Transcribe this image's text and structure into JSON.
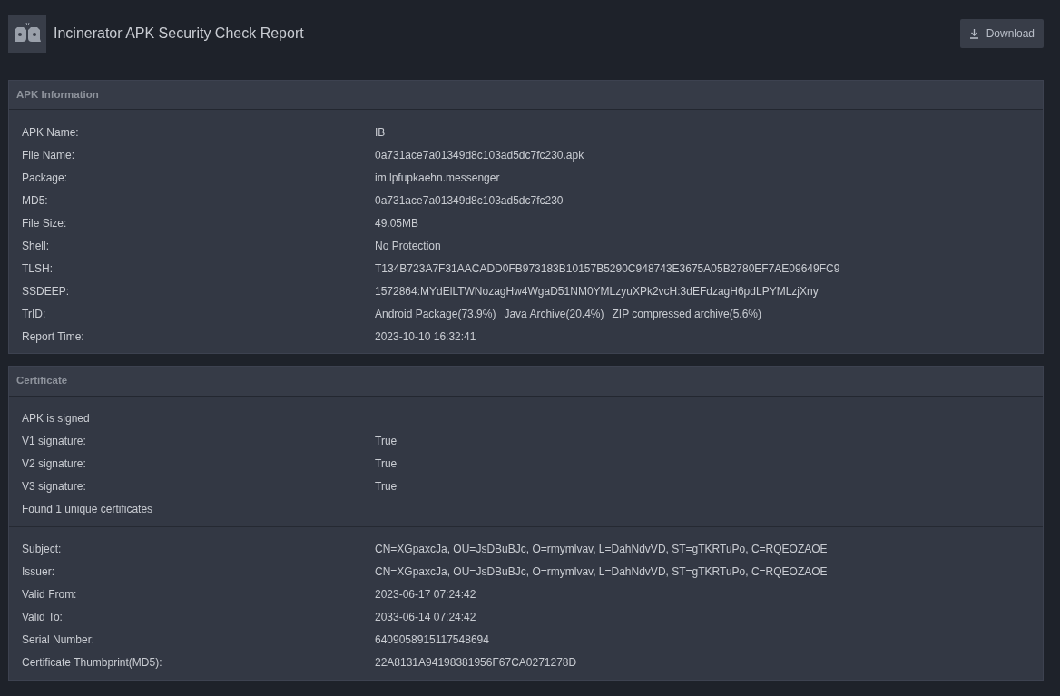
{
  "header": {
    "title": "Incinerator APK Security Check Report",
    "download_button": "Download"
  },
  "sections": [
    {
      "title": "APK Information",
      "groups": [
        [
          {
            "label": "APK Name:",
            "values": [
              "IB"
            ]
          },
          {
            "label": "File Name:",
            "values": [
              "0a731ace7a01349d8c103ad5dc7fc230.apk"
            ]
          },
          {
            "label": "Package:",
            "values": [
              "im.lpfupkaehn.messenger"
            ]
          },
          {
            "label": "MD5:",
            "values": [
              "0a731ace7a01349d8c103ad5dc7fc230"
            ]
          },
          {
            "label": "File Size:",
            "values": [
              "49.05MB"
            ]
          },
          {
            "label": "Shell:",
            "values": [
              "No Protection"
            ]
          },
          {
            "label": "TLSH:",
            "values": [
              "T134B723A7F31AACADD0FB973183B10157B5290C948743E3675A05B2780EF7AE09649FC9"
            ]
          },
          {
            "label": "SSDEEP:",
            "values": [
              "1572864:MYdElLTWNozagHw4WgaD51NM0YMLzyuXPk2vcH:3dEFdzagH6pdLPYMLzjXny"
            ]
          },
          {
            "label": "TrID:",
            "values": [
              "Android Package(73.9%)",
              "Java Archive(20.4%)",
              "ZIP compressed archive(5.6%)"
            ]
          },
          {
            "label": "Report Time:",
            "values": [
              "2023-10-10 16:32:41"
            ]
          }
        ]
      ]
    },
    {
      "title": "Certificate",
      "groups": [
        [
          {
            "label": "APK is signed"
          },
          {
            "label": "V1 signature:",
            "values": [
              "True"
            ]
          },
          {
            "label": "V2 signature:",
            "values": [
              "True"
            ]
          },
          {
            "label": "V3 signature:",
            "values": [
              "True"
            ]
          },
          {
            "label": "Found 1 unique certificates"
          }
        ],
        [
          {
            "label": "Subject:",
            "values": [
              "CN=XGpaxcJa, OU=JsDBuBJc, O=rmymlvav, L=DahNdvVD, ST=gTKRTuPo, C=RQEOZAOE"
            ]
          },
          {
            "label": "Issuer:",
            "values": [
              "CN=XGpaxcJa, OU=JsDBuBJc, O=rmymlvav, L=DahNdvVD, ST=gTKRTuPo, C=RQEOZAOE"
            ]
          },
          {
            "label": "Valid From:",
            "values": [
              "2023-06-17 07:24:42"
            ]
          },
          {
            "label": "Valid To:",
            "values": [
              "2033-06-14 07:24:42"
            ]
          },
          {
            "label": "Serial Number:",
            "values": [
              "6409058915117548694"
            ]
          },
          {
            "label": "Certificate Thumbprint(MD5):",
            "values": [
              "22A8131A94198381956F67CA0271278D"
            ]
          }
        ]
      ]
    }
  ]
}
